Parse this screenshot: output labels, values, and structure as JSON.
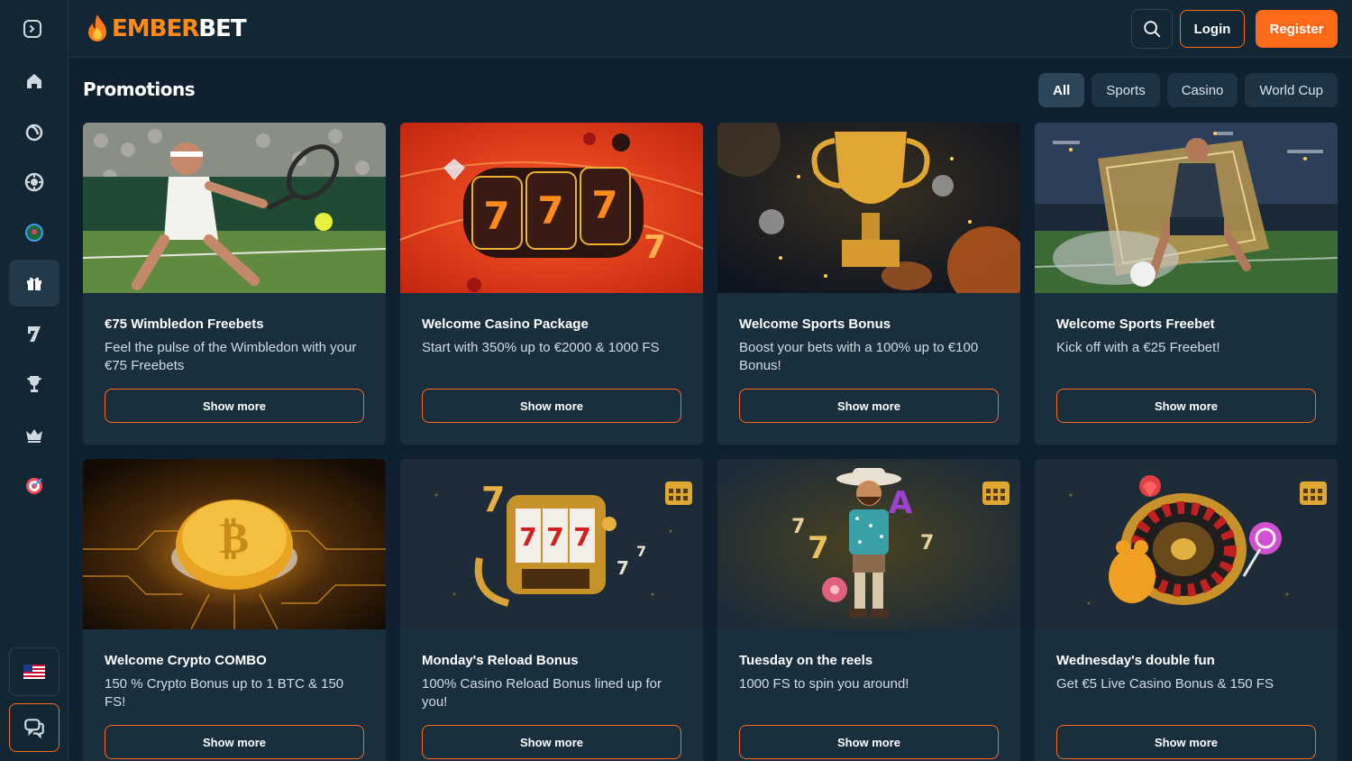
{
  "brand": {
    "name_part1": "EMBER",
    "name_part2": "BET",
    "accent": "#ff6a1a"
  },
  "header": {
    "login_label": "Login",
    "register_label": "Register"
  },
  "sidebar": {
    "items": [
      {
        "icon": "home-icon"
      },
      {
        "icon": "sports-icon"
      },
      {
        "icon": "casino-chip-icon"
      },
      {
        "icon": "football-icon"
      },
      {
        "icon": "gift-icon"
      },
      {
        "icon": "seven-icon"
      },
      {
        "icon": "trophy-icon"
      },
      {
        "icon": "crown-icon"
      },
      {
        "icon": "target-icon"
      }
    ],
    "language_flag": "us-flag-icon",
    "chat": "chat-icon"
  },
  "main": {
    "title": "Promotions",
    "filters": [
      {
        "label": "All"
      },
      {
        "label": "Sports"
      },
      {
        "label": "Casino"
      },
      {
        "label": "World Cup"
      }
    ]
  },
  "promotions": [
    {
      "title": "€75 Wimbledon Freebets",
      "description": "Feel the pulse of the Wimbledon with your €75 Freebets",
      "button": "Show more",
      "image": "tennis"
    },
    {
      "title": "Welcome Casino Package",
      "description": "Start with 350% up to €2000 & 1000 FS",
      "button": "Show more",
      "image": "slot-red"
    },
    {
      "title": "Welcome Sports Bonus",
      "description": "Boost your bets with a 100% up to €100 Bonus!",
      "button": "Show more",
      "image": "trophy"
    },
    {
      "title": "Welcome Sports Freebet",
      "description": "Kick off with a €25 Freebet!",
      "button": "Show more",
      "image": "football-ticket"
    },
    {
      "title": "Welcome Crypto COMBO",
      "description": "150 % Crypto Bonus up to 1 BTC & 150 FS!",
      "button": "Show more",
      "image": "bitcoin"
    },
    {
      "title": "Monday's Reload Bonus",
      "description": "100% Casino Reload Bonus lined up for you!",
      "button": "Show more",
      "image": "slot-gold"
    },
    {
      "title": "Tuesday on the reels",
      "description": "1000 FS to spin you around!",
      "button": "Show more",
      "image": "cowboy"
    },
    {
      "title": "Wednesday's double fun",
      "description": "Get €5 Live Casino Bonus & 150 FS",
      "button": "Show more",
      "image": "roulette"
    }
  ]
}
